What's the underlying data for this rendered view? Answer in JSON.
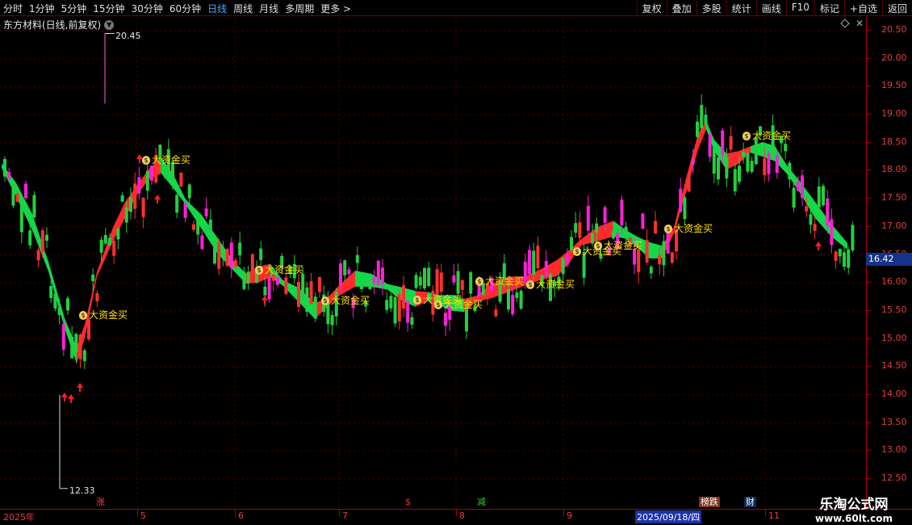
{
  "toolbar": {
    "periods": [
      "分时",
      "1分钟",
      "5分钟",
      "15分钟",
      "30分钟",
      "60分钟",
      "日线",
      "周线",
      "月线",
      "多周期",
      "更多 >"
    ],
    "active_period": "日线",
    "tools": [
      "复权",
      "叠加",
      "多股",
      "统计",
      "画线",
      "F10",
      "标记",
      "+自选",
      "返回"
    ]
  },
  "header": {
    "stock_title": "东方材料(日线,前复权)"
  },
  "axis": {
    "ticks": [
      "20.50",
      "20.00",
      "19.50",
      "19.00",
      "18.50",
      "18.00",
      "17.50",
      "17.00",
      "16.50",
      "16.00",
      "15.50",
      "15.00",
      "14.50",
      "14.00",
      "13.50",
      "13.00",
      "12.50"
    ],
    "current_price": "16.42"
  },
  "annotations": {
    "high": "20.45",
    "low": "12.33",
    "signal_text": "大资金买"
  },
  "timeline": {
    "labels": [
      "2025年",
      "5",
      "6",
      "7",
      "8",
      "9",
      "2025/09/18/四",
      "11"
    ],
    "badges": [
      {
        "text": "涨",
        "color": "#ff4040",
        "bg": "#000"
      },
      {
        "text": "$",
        "color": "#ff3030",
        "bg": "#000"
      },
      {
        "text": "减",
        "color": "#30d030",
        "bg": "#000"
      },
      {
        "text": "榜跌",
        "color": "#ffffff",
        "bg": "#803020"
      },
      {
        "text": "财",
        "color": "#ffffff",
        "bg": "#0b2a5a"
      }
    ]
  },
  "watermark": {
    "line1": "乐淘公式网",
    "line2": "www.60lt.com"
  },
  "colors": {
    "up": "#ff3030",
    "up_magenta": "#ff20d8",
    "down": "#22d040",
    "ribbon_up": "#ff2a2a",
    "ribbon_down": "#12d84a",
    "signal": "#ffe000",
    "axis": "#e04040"
  }
}
